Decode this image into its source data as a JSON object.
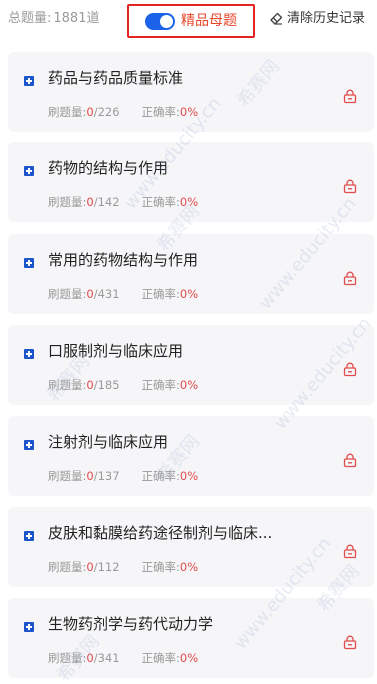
{
  "header": {
    "total_label": "总题量:",
    "total_value": "1881道",
    "premium_toggle": {
      "label": "精品母题",
      "on": true
    },
    "clear_history_label": "清除历史记录"
  },
  "stats_labels": {
    "practiced": "刷题量:",
    "accuracy": "正确率:"
  },
  "chapters": [
    {
      "title": "药品与药品质量标准",
      "done": "0",
      "total": "226",
      "accuracy": "0%"
    },
    {
      "title": "药物的结构与作用",
      "done": "0",
      "total": "142",
      "accuracy": "0%"
    },
    {
      "title": "常用的药物结构与作用",
      "done": "0",
      "total": "431",
      "accuracy": "0%"
    },
    {
      "title": "口服制剂与临床应用",
      "done": "0",
      "total": "185",
      "accuracy": "0%"
    },
    {
      "title": "注射剂与临床应用",
      "done": "0",
      "total": "137",
      "accuracy": "0%"
    },
    {
      "title": "皮肤和黏膜给药途径制剂与临床...",
      "done": "0",
      "total": "112",
      "accuracy": "0%"
    },
    {
      "title": "生物药剂学与药代动力学",
      "done": "0",
      "total": "341",
      "accuracy": "0%"
    }
  ],
  "watermark": {
    "brand": "希赛网",
    "url": "www.educity.cn"
  },
  "icons": {
    "toggle": "toggle-switch",
    "clear": "eraser-icon",
    "chapter": "plus-square-icon",
    "locked": "lock-icon"
  },
  "colors": {
    "accent_blue": "#1a63e8",
    "highlight_red": "#e52323",
    "premium_text": "#e8472b",
    "stat_red": "#e24b4b",
    "card_bg": "#f6f6f8"
  }
}
